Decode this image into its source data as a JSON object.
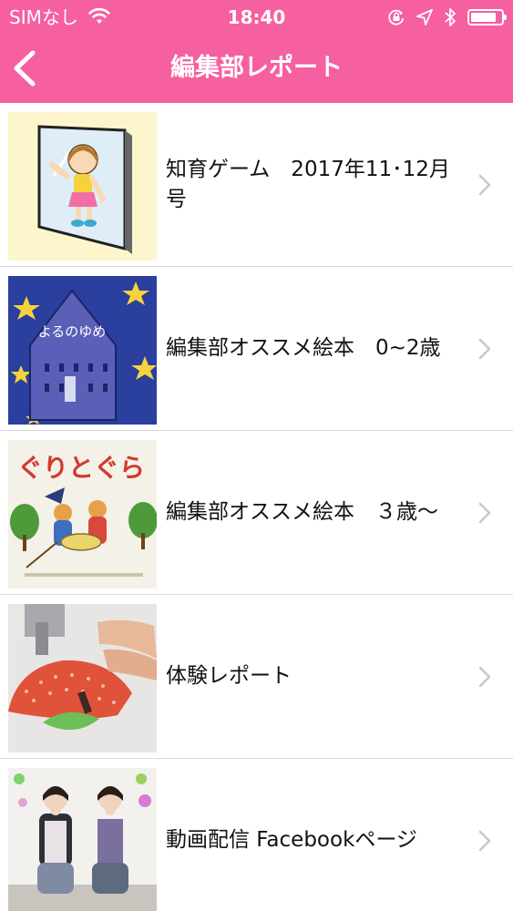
{
  "status_bar": {
    "carrier": "SIMなし",
    "time": "18:40",
    "battery_level": 0.85,
    "icons": [
      "wifi-icon",
      "orientation-lock-icon",
      "location-icon",
      "bluetooth-icon",
      "battery-icon"
    ]
  },
  "nav": {
    "title": "編集部レポート",
    "back_icon": "chevron-left-icon"
  },
  "colors": {
    "brand_pink": "#f65fa0",
    "text": "#111111",
    "chevron": "#c7c7cc",
    "separator": "#d9d9d9"
  },
  "items": [
    {
      "label": "知育ゲーム　2017年11･12月号",
      "thumbnail": "girl-mirror-illustration",
      "chevron": "chevron-right-icon"
    },
    {
      "label": "編集部オススメ絵本　0~2歳",
      "thumbnail": "picture-book-night-stars",
      "thumb_text": "よるのゆめ",
      "chevron": "chevron-right-icon"
    },
    {
      "label": "編集部オススメ絵本　３歳～",
      "thumbnail": "picture-book-guri-gura",
      "thumb_text": "ぐりとぐら",
      "chevron": "chevron-right-icon"
    },
    {
      "label": "体験レポート",
      "thumbnail": "sewing-machine-photo",
      "chevron": "chevron-right-icon"
    },
    {
      "label": "動画配信 Facebookページ",
      "thumbnail": "two-women-photo",
      "chevron": "chevron-right-icon"
    }
  ]
}
